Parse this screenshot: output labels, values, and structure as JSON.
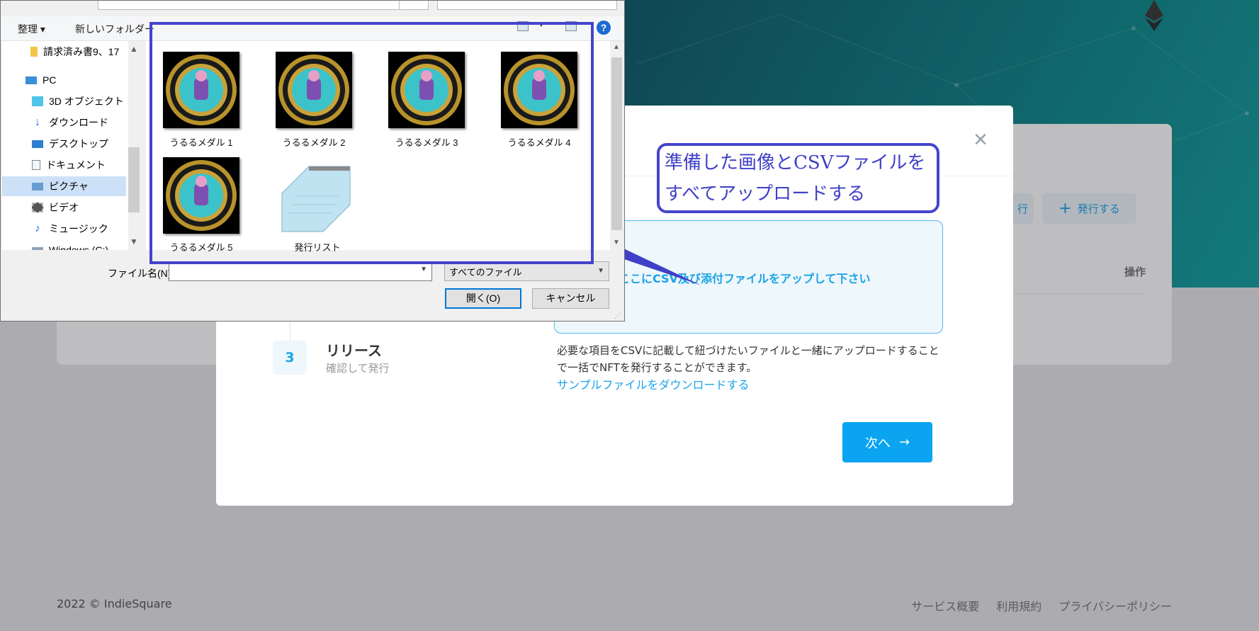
{
  "page": {
    "issue_button_label": "発行する",
    "issue_button_icon": "plus-icon",
    "secondary_button_label": "行",
    "ops_column": "操作",
    "footer": {
      "copyright": "2022 ©",
      "brand": "IndieSquare",
      "links": [
        "サービス概要",
        "利用規約",
        "プライバシーポリシー"
      ]
    }
  },
  "modal": {
    "close_icon": "close-icon",
    "dropzone_text": "ここにCSV及び添付ファイルをアップして下さい",
    "step": {
      "number": "3",
      "title": "リリース",
      "subtitle": "確認して発行"
    },
    "description": "必要な項目をCSVに記載して紐づけたいファイルと一緒にアップロードすることで一括でNFTを発行することができます。",
    "sample_link": "サンプルファイルをダウンロードする",
    "next_button": "次へ",
    "accent_color": "#0aa4f0"
  },
  "annotation": {
    "line1": "準備した画像とCSVファイルを",
    "line2": "すべてアップロードする",
    "color": "#4444cc"
  },
  "dialog": {
    "toolbar": {
      "organize": "整理 ▾",
      "new_folder": "新しいフォルダー"
    },
    "nav_items": [
      {
        "label": "請求済み書9、17",
        "icon": "folder-icon"
      },
      {
        "label": "PC",
        "icon": "pc-icon"
      },
      {
        "label": "3D オブジェクト",
        "icon": "3d-objects-icon"
      },
      {
        "label": "ダウンロード",
        "icon": "download-icon"
      },
      {
        "label": "デスクトップ",
        "icon": "desktop-icon"
      },
      {
        "label": "ドキュメント",
        "icon": "document-icon"
      },
      {
        "label": "ピクチャ",
        "icon": "pictures-icon"
      },
      {
        "label": "ビデオ",
        "icon": "video-icon"
      },
      {
        "label": "ミュージック",
        "icon": "music-icon"
      },
      {
        "label": "Windows (C:)",
        "icon": "drive-icon"
      }
    ],
    "files": [
      {
        "label": "うるるメダル 1",
        "icon": "medal-image-icon"
      },
      {
        "label": "うるるメダル 2",
        "icon": "medal-image-icon"
      },
      {
        "label": "うるるメダル 3",
        "icon": "medal-image-icon"
      },
      {
        "label": "うるるメダル 4",
        "icon": "medal-image-icon"
      },
      {
        "label": "うるるメダル 5",
        "icon": "medal-image-icon"
      },
      {
        "label": "発行リスト",
        "icon": "notepad-icon"
      }
    ],
    "filename_label": "ファイル名(N):",
    "filename_value": "",
    "filetype": "すべてのファイル",
    "open_button": "開く(O)",
    "cancel_button": "キャンセル",
    "help_label": "?"
  }
}
